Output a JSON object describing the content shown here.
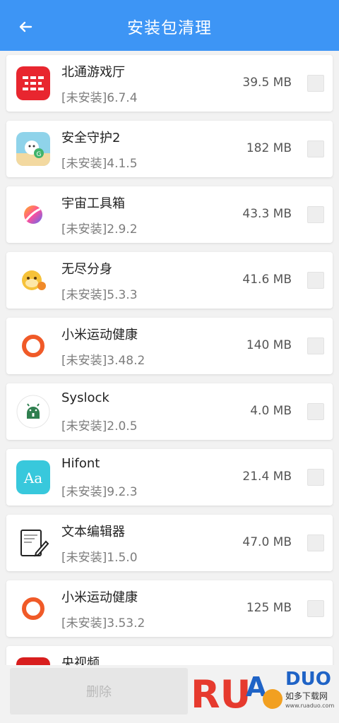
{
  "header": {
    "title": "安装包清理",
    "back_icon": "arrow-left-icon"
  },
  "apps": [
    {
      "name": "北通游戏厅",
      "status": "[未安装]6.7.4",
      "size": "39.5 MB",
      "icon": "betop-logo-icon",
      "color": "#e8262f"
    },
    {
      "name": "安全守护2",
      "status": "[未安装]4.1.5",
      "size": "182 MB",
      "icon": "beach-character-icon",
      "color": "#8fd3ea"
    },
    {
      "name": "宇宙工具箱",
      "status": "[未安装]2.9.2",
      "size": "43.3 MB",
      "icon": "gradient-planet-icon",
      "color": "#7b57f0"
    },
    {
      "name": "无尽分身",
      "status": "[未安装]5.3.3",
      "size": "41.6 MB",
      "icon": "yellow-monkey-icon",
      "color": "#f6c23a"
    },
    {
      "name": "小米运动健康",
      "status": "[未安装]3.48.2",
      "size": "140 MB",
      "icon": "orange-ring-icon",
      "color": "#f05a28"
    },
    {
      "name": "Syslock",
      "status": "[未安装]2.0.5",
      "size": "4.0 MB",
      "icon": "android-lock-icon",
      "color": "#2f7f4f"
    },
    {
      "name": "Hifont",
      "status": "[未安装]9.2.3",
      "size": "21.4 MB",
      "icon": "font-aa-icon",
      "color": "#38c8dc"
    },
    {
      "name": "文本编辑器",
      "status": "[未安装]1.5.0",
      "size": "47.0 MB",
      "icon": "notepad-pen-icon",
      "color": "#222222"
    },
    {
      "name": "小米运动健康",
      "status": "[未安装]3.53.2",
      "size": "125 MB",
      "icon": "orange-ring-icon",
      "color": "#f05a28"
    },
    {
      "name": "央视频",
      "status": "",
      "size": "",
      "icon": "cctv-video-icon",
      "color": "#d81e1e"
    }
  ],
  "footer": {
    "delete_label": "删除"
  },
  "watermark": {
    "text": "RUANDUO",
    "cn": "如多下载网",
    "url": "www.ruaduo.com",
    "icon": "ruaduo-logo-icon"
  }
}
